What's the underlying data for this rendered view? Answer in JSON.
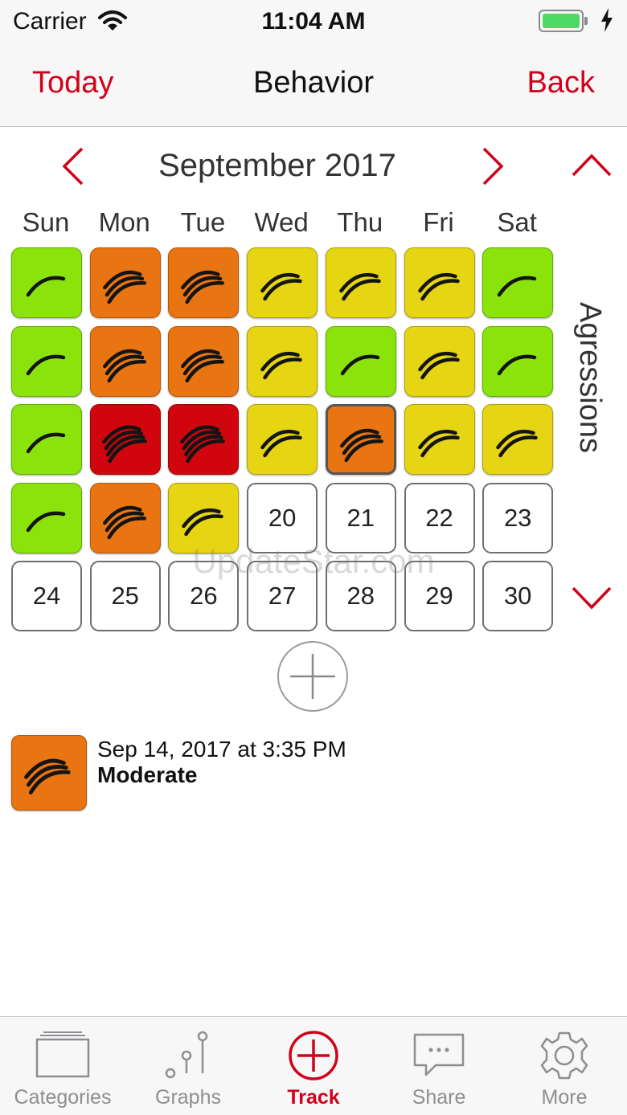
{
  "status_bar": {
    "carrier": "Carrier",
    "time": "11:04 AM"
  },
  "nav": {
    "left_label": "Today",
    "title": "Behavior",
    "right_label": "Back"
  },
  "calendar": {
    "month_label": "September 2017",
    "weekdays": [
      "Sun",
      "Mon",
      "Tue",
      "Wed",
      "Thu",
      "Fri",
      "Sat"
    ],
    "side_label": "Agressions",
    "colors": {
      "green": "#8ae30a",
      "yellow": "#e6d513",
      "orange": "#e87511",
      "red": "#d0050d"
    },
    "weeks": [
      [
        {
          "mark": "green",
          "strokes": 1
        },
        {
          "mark": "orange",
          "strokes": 3
        },
        {
          "mark": "orange",
          "strokes": 3
        },
        {
          "mark": "yellow",
          "strokes": 2
        },
        {
          "mark": "yellow",
          "strokes": 2
        },
        {
          "mark": "yellow",
          "strokes": 2
        },
        {
          "mark": "green",
          "strokes": 1
        }
      ],
      [
        {
          "mark": "green",
          "strokes": 1
        },
        {
          "mark": "orange",
          "strokes": 3
        },
        {
          "mark": "orange",
          "strokes": 3
        },
        {
          "mark": "yellow",
          "strokes": 2
        },
        {
          "mark": "green",
          "strokes": 1
        },
        {
          "mark": "yellow",
          "strokes": 2
        },
        {
          "mark": "green",
          "strokes": 1
        }
      ],
      [
        {
          "mark": "green",
          "strokes": 1
        },
        {
          "mark": "red",
          "strokes": 4
        },
        {
          "mark": "red",
          "strokes": 4
        },
        {
          "mark": "yellow",
          "strokes": 2
        },
        {
          "mark": "orange",
          "strokes": 3,
          "selected": true
        },
        {
          "mark": "yellow",
          "strokes": 2
        },
        {
          "mark": "yellow",
          "strokes": 2
        }
      ],
      [
        {
          "mark": "green",
          "strokes": 1
        },
        {
          "mark": "orange",
          "strokes": 3
        },
        {
          "mark": "yellow",
          "strokes": 2
        },
        {
          "day": "20"
        },
        {
          "day": "21"
        },
        {
          "day": "22"
        },
        {
          "day": "23"
        }
      ],
      [
        {
          "day": "24"
        },
        {
          "day": "25"
        },
        {
          "day": "26"
        },
        {
          "day": "27"
        },
        {
          "day": "28"
        },
        {
          "day": "29"
        },
        {
          "day": "30"
        }
      ]
    ]
  },
  "entry": {
    "date_text": "Sep 14, 2017 at 3:35 PM",
    "level": "Moderate",
    "mark": "orange",
    "strokes": 3
  },
  "watermark": "UpdateStar.com",
  "tabs": [
    {
      "id": "categories",
      "label": "Categories",
      "icon": "folder-icon",
      "active": false
    },
    {
      "id": "graphs",
      "label": "Graphs",
      "icon": "graphs-icon",
      "active": false
    },
    {
      "id": "track",
      "label": "Track",
      "icon": "plus-circle-icon",
      "active": true
    },
    {
      "id": "share",
      "label": "Share",
      "icon": "speech-bubble-icon",
      "active": false
    },
    {
      "id": "more",
      "label": "More",
      "icon": "gear-icon",
      "active": false
    }
  ],
  "accent_color": "#d0021b"
}
